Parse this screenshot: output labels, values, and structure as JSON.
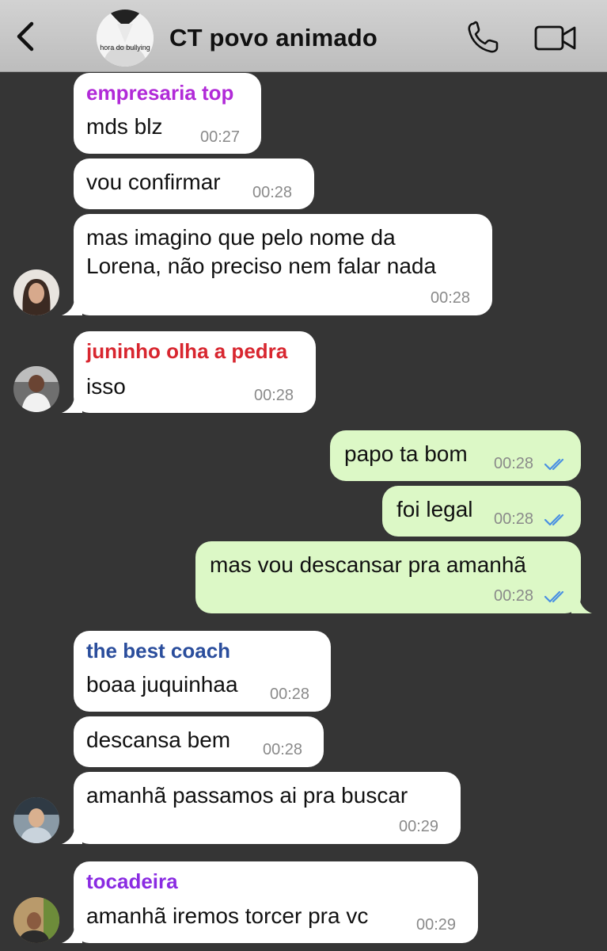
{
  "header": {
    "title": "CT povo animado",
    "avatar_caption": "hora do bullying",
    "icons": [
      "back-icon",
      "phone-icon",
      "video-camera-icon"
    ]
  },
  "colors": {
    "incoming": "#ffffff",
    "outgoing": "#dcf8c6",
    "background": "#353535",
    "ticks": "#4a90e2",
    "sender_empresaria": "#b12ad8",
    "sender_juninho": "#d8262f",
    "sender_coach": "#2a4d9c",
    "sender_tocadeira": "#8a2be2"
  },
  "messages": [
    {
      "sender": "empresaria top",
      "text": "mds blz",
      "time": "00:27"
    },
    {
      "text": "vou confirmar",
      "time": "00:28"
    },
    {
      "lines": [
        "mas imagino que pelo nome da",
        "Lorena, não preciso nem falar nada"
      ],
      "time": "00:28"
    },
    {
      "sender": "juninho olha a pedra",
      "text": "isso",
      "time": "00:28"
    },
    {
      "text": "papo ta bom",
      "time": "00:28",
      "read": true
    },
    {
      "text": "foi legal",
      "time": "00:28",
      "read": true
    },
    {
      "text": "mas vou descansar pra amanhã",
      "time": "00:28",
      "read": true
    },
    {
      "sender": "the best coach",
      "text": "boaa juquinhaa",
      "time": "00:28"
    },
    {
      "text": "descansa bem",
      "time": "00:28"
    },
    {
      "text": "amanhã passamos ai pra buscar",
      "time": "00:29"
    },
    {
      "sender": "tocadeira",
      "text": "amanhã iremos torcer pra vc",
      "time": "00:29"
    }
  ]
}
